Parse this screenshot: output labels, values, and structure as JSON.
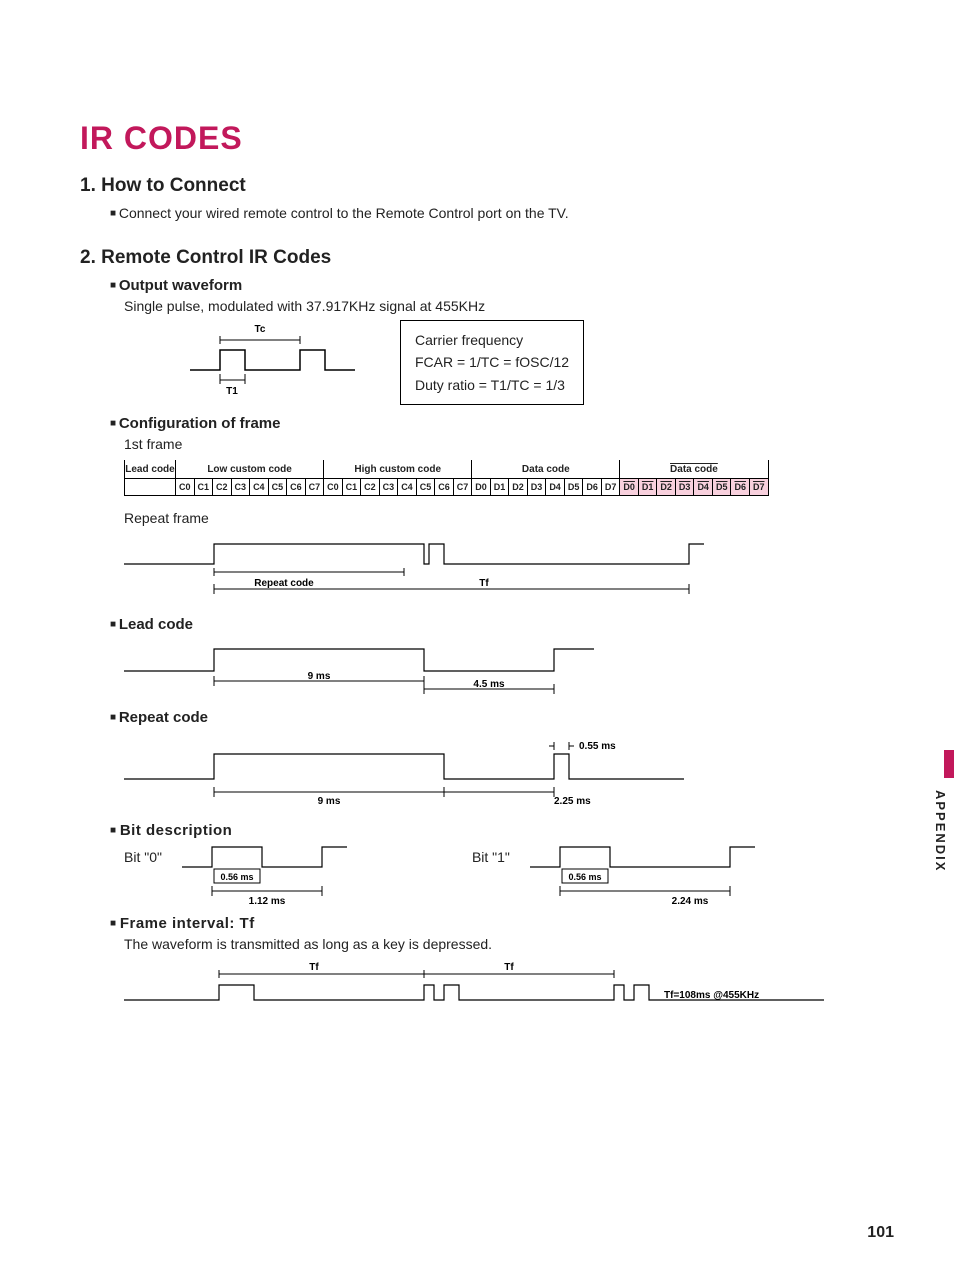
{
  "title": "IR CODES",
  "section1": {
    "heading": "1. How to Connect",
    "body": "Connect your wired remote control to the Remote Control port on the TV."
  },
  "section2": {
    "heading": "2. Remote Control IR Codes",
    "output_waveform": {
      "label": "Output waveform",
      "desc": "Single pulse, modulated with 37.917KHz signal at 455KHz",
      "tc": "Tc",
      "t1": "T1",
      "carrier": {
        "line1": "Carrier frequency",
        "line2": "FCAR = 1/TC = fOSC/12",
        "line3": "Duty ratio = T1/TC = 1/3"
      }
    },
    "config_frame": {
      "label": "Configuration of frame",
      "first_frame": "1st frame",
      "headers": [
        "Lead code",
        "Low custom code",
        "High custom code",
        "Data code",
        "Data code"
      ],
      "low_bits": [
        "C0",
        "C1",
        "C2",
        "C3",
        "C4",
        "C5",
        "C6",
        "C7"
      ],
      "high_bits": [
        "C0",
        "C1",
        "C2",
        "C3",
        "C4",
        "C5",
        "C6",
        "C7"
      ],
      "data1_bits": [
        "D0",
        "D1",
        "D2",
        "D3",
        "D4",
        "D5",
        "D6",
        "D7"
      ],
      "data2_bits": [
        "D0",
        "D1",
        "D2",
        "D3",
        "D4",
        "D5",
        "D6",
        "D7"
      ],
      "repeat_frame": "Repeat frame",
      "repeat_code_label": "Repeat  code",
      "tf_label": "Tf"
    },
    "lead_code": {
      "label": "Lead code",
      "t_high": "9 ms",
      "t_low": "4.5 ms"
    },
    "repeat_code": {
      "label": "Repeat code",
      "pulse": "0.55 ms",
      "t_high": "9 ms",
      "t_low": "2.25 ms"
    },
    "bit_desc": {
      "label": "Bit description",
      "bit0": "Bit \"0\"",
      "bit1": "Bit \"1\"",
      "pulse": "0.56 ms",
      "t0": "1.12 ms",
      "t1": "2.24 ms"
    },
    "frame_interval": {
      "label": "Frame interval: Tf",
      "desc": "The waveform is transmitted as long as a key is depressed.",
      "tf": "Tf",
      "note": "Tf=108ms @455KHz"
    }
  },
  "side_tab": "APPENDIX",
  "page_number": "101"
}
